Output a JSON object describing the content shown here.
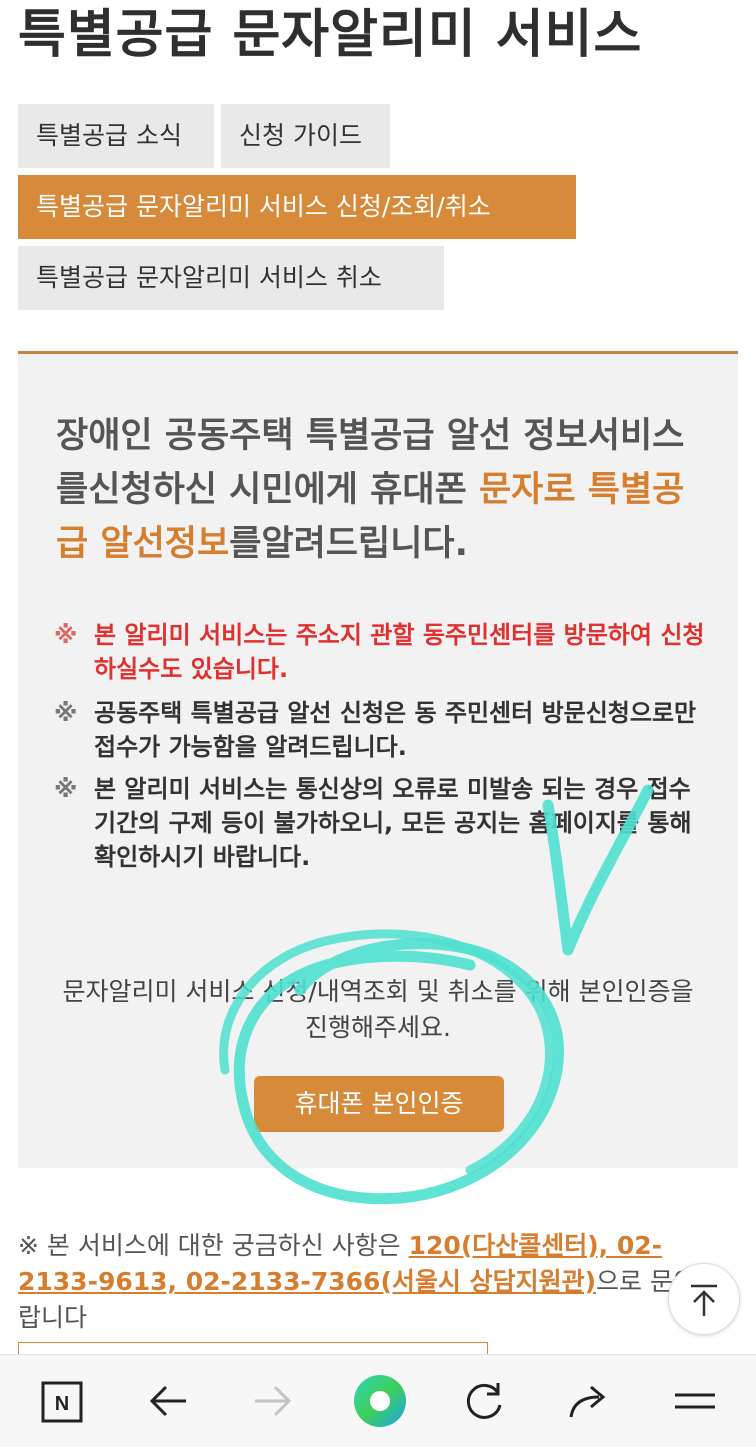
{
  "page": {
    "title": "특별공급 문자알리미 서비스"
  },
  "tabs": [
    {
      "label": "특별공급 소식",
      "active": false
    },
    {
      "label": "신청 가이드",
      "active": false
    },
    {
      "label": "특별공급 문자알리미 서비스 신청/조회/취소",
      "active": true
    },
    {
      "label": "특별공급 문자알리미 서비스 취소",
      "active": false
    }
  ],
  "panel": {
    "headline_part1": "장애인 공동주택 특별공급 알선 정보서비스를신청하신 시민에게 휴대폰 ",
    "headline_highlight": "문자로 특별공급 알선정보",
    "headline_part2": "를알려드립니다.",
    "notes": [
      {
        "mark": "※",
        "text": "본 알리미 서비스는 주소지 관할 동주민센터를 방문하여 신청하실수도 있습니다.",
        "style": "red"
      },
      {
        "mark": "※",
        "text": "공동주택 특별공급 알선 신청은 동 주민센터 방문신청으로만 접수가 가능함을 알려드립니다.",
        "style": "normal"
      },
      {
        "mark": "※",
        "text": "본 알리미 서비스는 통신상의 오류로 미발송 되는 경우 접수 기간의 구제 등이 불가하오니, 모든 공지는 홈페이지를 통해 확인하시기 바랍니다.",
        "style": "normal"
      }
    ],
    "auth_text": "문자알리미 서비스 신청/내역조회 및 취소를 위해 본인인증을 진행해주세요.",
    "auth_button": "휴대폰 본인인증"
  },
  "contact": {
    "prefix": "※ 본 서비스에 대한 궁금하신 사항은 ",
    "link": "120(다산콜센터), 02-2133-9613, 02-2133-7366(서울시 상담지원관)",
    "suffix": "으로 문의 바랍니다"
  },
  "bottom_nav": {
    "n_label": "N",
    "icons": [
      "naver-n-icon",
      "back-arrow-icon",
      "forward-arrow-icon",
      "green-circle-icon",
      "refresh-icon",
      "share-icon",
      "menu-icon"
    ]
  },
  "colors": {
    "accent": "#d68a3a",
    "accent_text": "#d67d2e",
    "warning_red": "#e03030",
    "panel_bg": "#f2f2f2",
    "annotation": "#4de0d0"
  }
}
